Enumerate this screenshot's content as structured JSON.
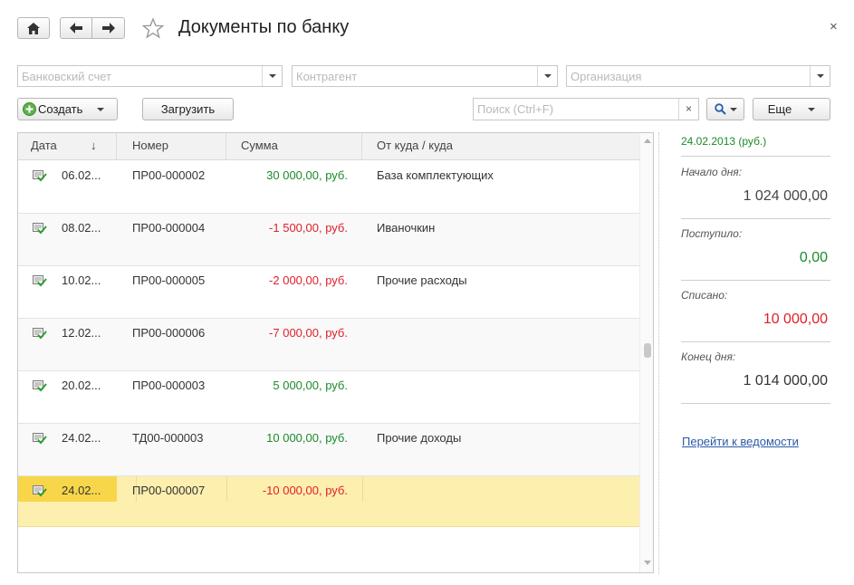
{
  "header": {
    "title": "Документы по банку",
    "close_glyph": "×"
  },
  "filters": {
    "bank_account_placeholder": "Банковский счет",
    "counterparty_placeholder": "Контрагент",
    "organization_placeholder": "Организация"
  },
  "toolbar": {
    "create_label": "Создать",
    "load_label": "Загрузить",
    "search_placeholder": "Поиск (Ctrl+F)",
    "clear_glyph": "×",
    "more_label": "Еще"
  },
  "table": {
    "columns": {
      "date": "Дата",
      "sort_arrow": "↓",
      "number": "Номер",
      "amount": "Сумма",
      "from_to": "От куда / куда"
    },
    "rows": [
      {
        "date": "06.02...",
        "number": "ПР00-000002",
        "amount": "30 000,00, руб.",
        "sign": "pos",
        "from_to": "База комплектующих"
      },
      {
        "date": "08.02...",
        "number": "ПР00-000004",
        "amount": "-1 500,00, руб.",
        "sign": "neg",
        "from_to": "Иваночкин"
      },
      {
        "date": "10.02...",
        "number": "ПР00-000005",
        "amount": "-2 000,00, руб.",
        "sign": "neg",
        "from_to": "Прочие расходы"
      },
      {
        "date": "12.02...",
        "number": "ПР00-000006",
        "amount": "-7 000,00, руб.",
        "sign": "neg",
        "from_to": ""
      },
      {
        "date": "20.02...",
        "number": "ПР00-000003",
        "amount": "5 000,00, руб.",
        "sign": "pos",
        "from_to": ""
      },
      {
        "date": "24.02...",
        "number": "ТД00-000003",
        "amount": "10 000,00, руб.",
        "sign": "pos",
        "from_to": "Прочие доходы"
      },
      {
        "date": "24.02...",
        "number": "ПР00-000007",
        "amount": "-10 000,00, руб.",
        "sign": "neg",
        "from_to": "",
        "selected": true
      }
    ]
  },
  "summary": {
    "date_label": "24.02.2013 (руб.)",
    "start_label": "Начало дня:",
    "start_value": "1 024 000,00",
    "in_label": "Поступило:",
    "in_value": "0,00",
    "out_label": "Списано:",
    "out_value": "10 000,00",
    "end_label": "Конец дня:",
    "end_value": "1 014 000,00",
    "statement_link": "Перейти к ведомости"
  },
  "colors": {
    "positive": "#1c8a2a",
    "negative": "#e0202a",
    "selection": "#fdefae",
    "link": "#2a5aa8"
  }
}
